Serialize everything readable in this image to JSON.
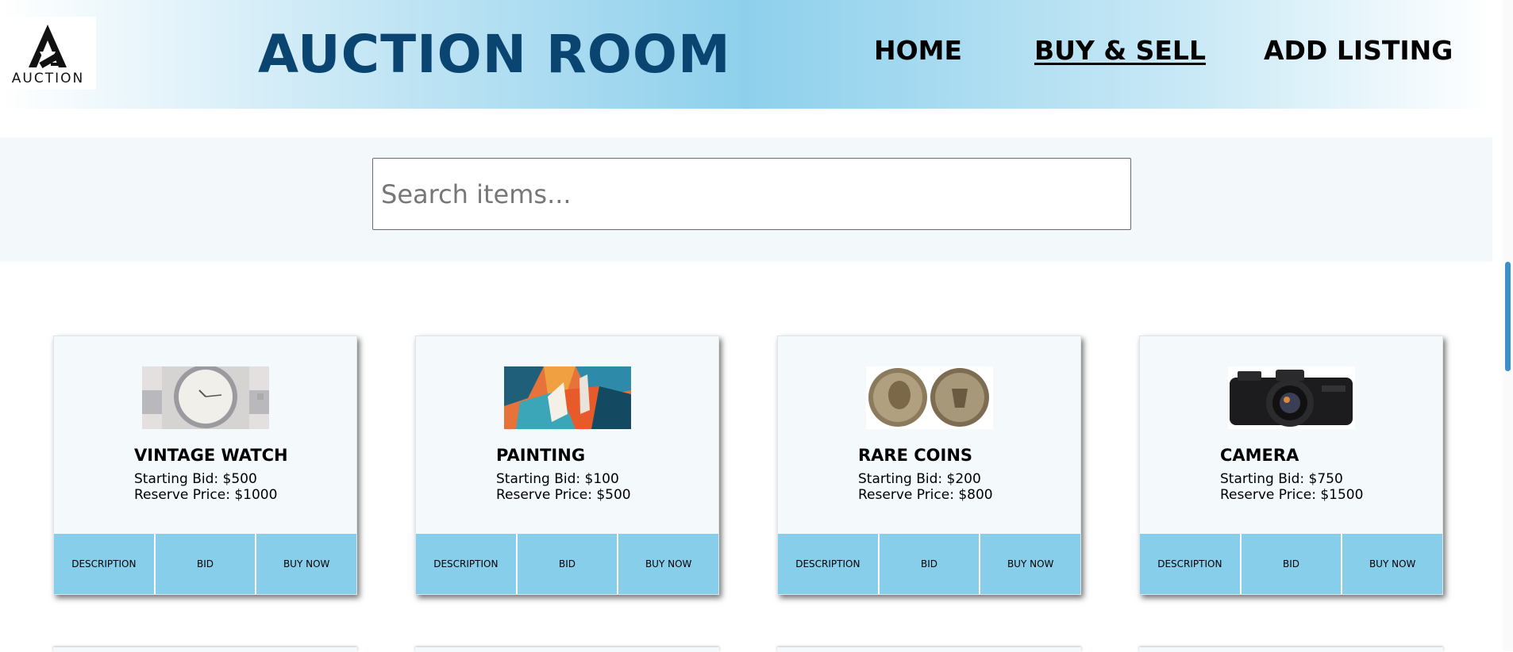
{
  "header": {
    "logo_text": "AUCTION",
    "title": "AUCTION ROOM",
    "nav": [
      {
        "label": "HOME",
        "active": false
      },
      {
        "label": "BUY & SELL",
        "active": true
      },
      {
        "label": "ADD LISTING",
        "active": false
      }
    ]
  },
  "search": {
    "placeholder": "Search items...",
    "value": ""
  },
  "listings": [
    {
      "title": "VINTAGE WATCH",
      "starting_bid": "Starting Bid: $500",
      "reserve_price": "Reserve Price: $1000",
      "image": "watch-image"
    },
    {
      "title": "PAINTING",
      "starting_bid": "Starting Bid: $100",
      "reserve_price": "Reserve Price: $500",
      "image": "abstract-painting-image"
    },
    {
      "title": "RARE COINS",
      "starting_bid": "Starting Bid: $200",
      "reserve_price": "Reserve Price: $800",
      "image": "coins-image"
    },
    {
      "title": "CAMERA",
      "starting_bid": "Starting Bid: $750",
      "reserve_price": "Reserve Price: $1500",
      "image": "camera-image"
    }
  ],
  "card_actions": {
    "description": "DESCRIPTION",
    "bid": "BID",
    "buy_now": "BUY NOW"
  },
  "colors": {
    "title": "#0a4470",
    "header_accent": "#8ed0ec",
    "button": "#87ceeb",
    "card_bg": "#f4f9fb",
    "scroll_thumb": "#3d8fc8"
  }
}
